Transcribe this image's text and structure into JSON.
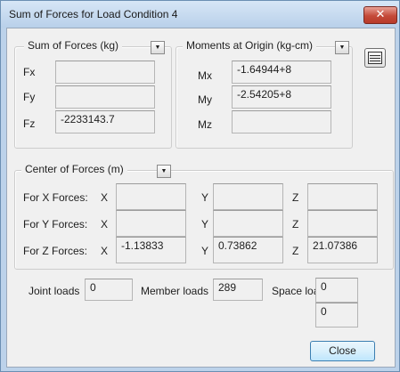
{
  "window": {
    "title": "Sum of Forces for Load Condition 4",
    "close_glyph": "✕"
  },
  "sum_of_forces": {
    "legend": "Sum of Forces (kg)",
    "rows": [
      {
        "label": "Fx",
        "value": ""
      },
      {
        "label": "Fy",
        "value": ""
      },
      {
        "label": "Fz",
        "value": "-2233143.7"
      }
    ]
  },
  "moments": {
    "legend": "Moments at Origin (kg-cm)",
    "rows": [
      {
        "label": "Mx",
        "value": "-1.64944+8"
      },
      {
        "label": "My",
        "value": "-2.54205+8"
      },
      {
        "label": "Mz",
        "value": ""
      }
    ]
  },
  "center_of_forces": {
    "legend": "Center of Forces (m)",
    "axis_labels": [
      "X",
      "Y",
      "Z"
    ],
    "rows": [
      {
        "label": "For X Forces:",
        "x": "",
        "y": "",
        "z": ""
      },
      {
        "label": "For Y Forces:",
        "x": "",
        "y": "",
        "z": ""
      },
      {
        "label": "For Z Forces:",
        "x": "-1.13833",
        "y": "0.73862",
        "z": "21.07386"
      }
    ]
  },
  "loads": {
    "joint_label": "Joint loads",
    "joint_value": "0",
    "member_label": "Member loads",
    "member_value": "289",
    "space_label": "Space loads",
    "space_value_1": "0",
    "space_value_2": "0"
  },
  "dropdown_glyph": "▼",
  "buttons": {
    "close": "Close"
  },
  "icons": {
    "list_button": "list-view-icon",
    "dropdown": "dropdown-arrow-icon"
  },
  "colors": {
    "title_bar": "#c4d8ee",
    "close_x": "#c44a39",
    "dialog_bg": "#f0f0f0",
    "default_button_border": "#3c7fb1"
  }
}
